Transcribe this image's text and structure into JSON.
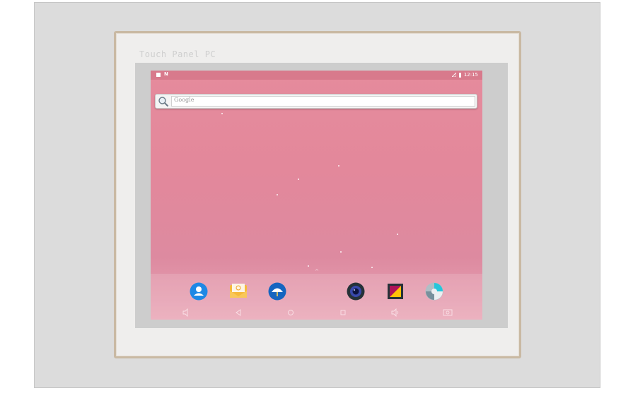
{
  "device": {
    "brand_label": "Touch Panel PC"
  },
  "status_bar": {
    "time": "12:15",
    "left_icons": [
      "sd-card-icon",
      "notification-n-icon"
    ],
    "right_icons": [
      "signal-icon",
      "battery-icon"
    ]
  },
  "search_widget": {
    "placeholder": "Google",
    "icon": "search-magnifier-icon"
  },
  "dock_apps": [
    {
      "name": "contacts",
      "icon": "contacts-icon"
    },
    {
      "name": "email",
      "icon": "email-icon"
    },
    {
      "name": "weather",
      "icon": "weather-umbrella-icon"
    },
    {
      "name": "camera",
      "icon": "camera-icon"
    },
    {
      "name": "gallery",
      "icon": "gallery-icon"
    },
    {
      "name": "browser",
      "icon": "browser-icon"
    }
  ],
  "nav_bar": [
    "volume-down-icon",
    "back-icon",
    "home-icon",
    "recents-icon",
    "volume-up-icon",
    "screenshot-icon"
  ],
  "colors": {
    "wallpaper": "#e58b9c",
    "bezel": "#efeeed",
    "bezel_border": "#c9b9a3"
  }
}
